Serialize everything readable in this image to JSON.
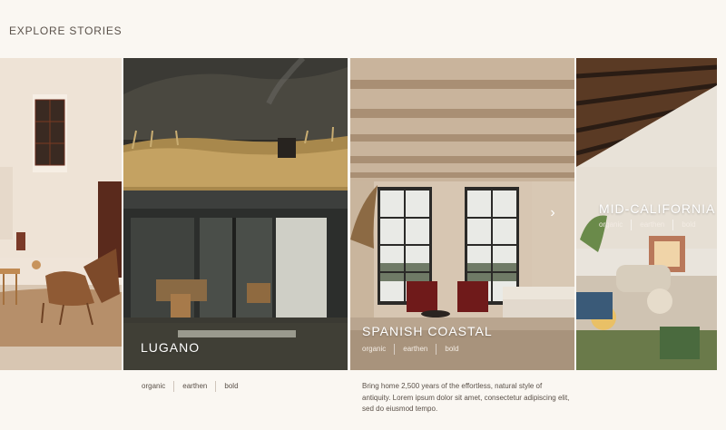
{
  "header": {
    "title": "EXPLORE STORIES"
  },
  "stories": [
    {
      "name": "",
      "tags": []
    },
    {
      "name": "LUGANO",
      "tags": [
        "organic",
        "earthen",
        "bold"
      ]
    },
    {
      "name": "SPANISH COASTAL",
      "tags": [
        "organic",
        "earthen",
        "bold"
      ],
      "description": "Bring home 2,500 years of the effortless, natural style of antiquity. Lorem ipsum dolor sit amet, consectetur adipiscing elit, sed do eiusmod tempo."
    },
    {
      "name": "MID-CALIFORNIA",
      "tags": [
        "organic",
        "earthen",
        "bold"
      ]
    }
  ],
  "below_tags": [
    "organic",
    "earthen",
    "bold"
  ],
  "controls": {
    "next_icon": "chevron-right-icon"
  }
}
